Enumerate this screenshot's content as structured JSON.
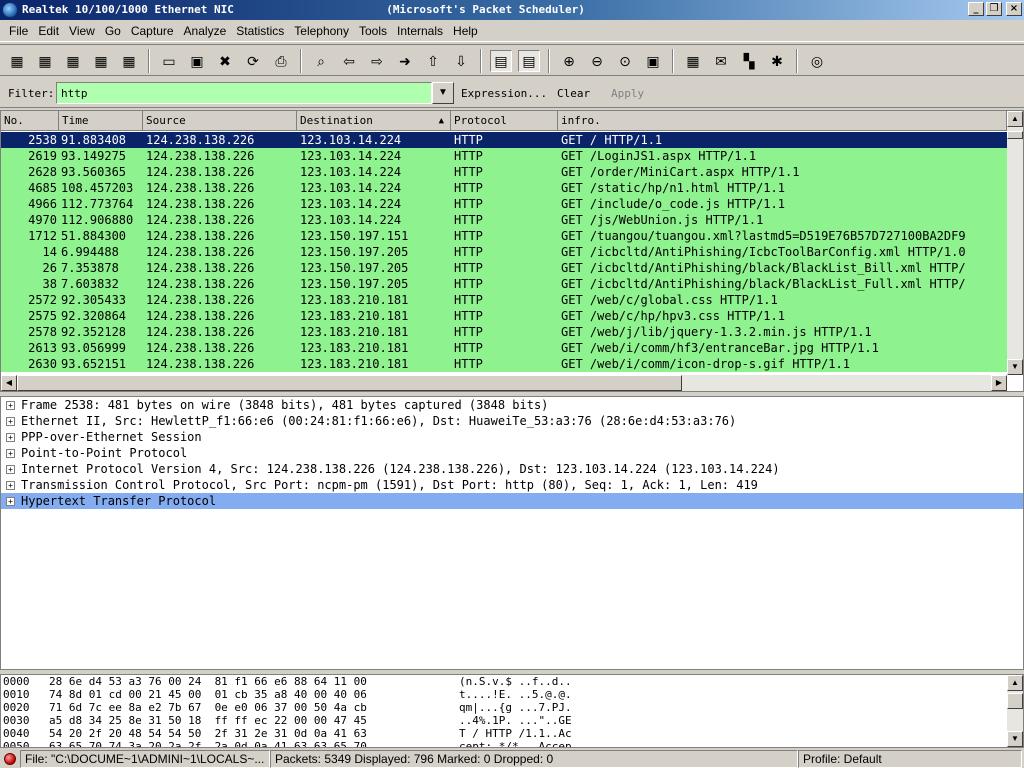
{
  "window": {
    "title": "Realtek 10/100/1000 Ethernet NIC                       (Microsoft's Packet Scheduler)",
    "minimize": "_",
    "maximize": "❐",
    "close": "×"
  },
  "menubar": {
    "items": [
      "File",
      "Edit",
      "View",
      "Go",
      "Capture",
      "Analyze",
      "Statistics",
      "Telephony",
      "Tools",
      "Internals",
      "Help"
    ]
  },
  "toolbar": {
    "icons": [
      {
        "name": "interfaces-icon",
        "glyph": "▦"
      },
      {
        "name": "capture-options-icon",
        "glyph": "▦"
      },
      {
        "name": "start-capture-icon",
        "glyph": "▦"
      },
      {
        "name": "stop-capture-icon",
        "glyph": "▦"
      },
      {
        "name": "restart-capture-icon",
        "glyph": "▦"
      },
      {
        "name": "open-file-icon",
        "glyph": "▭"
      },
      {
        "name": "save-file-icon",
        "glyph": "▣"
      },
      {
        "name": "close-file-icon",
        "glyph": "✖"
      },
      {
        "name": "reload-icon",
        "glyph": "⟳"
      },
      {
        "name": "print-icon",
        "glyph": "⎙"
      },
      {
        "name": "find-packet-icon",
        "glyph": "⌕"
      },
      {
        "name": "go-back-icon",
        "glyph": "⇦"
      },
      {
        "name": "go-forward-icon",
        "glyph": "⇨"
      },
      {
        "name": "go-to-packet-icon",
        "glyph": "➜"
      },
      {
        "name": "go-first-icon",
        "glyph": "⇧"
      },
      {
        "name": "go-last-icon",
        "glyph": "⇩"
      },
      {
        "name": "colorize-icon",
        "glyph": "▤"
      },
      {
        "name": "auto-scroll-icon",
        "glyph": "▤"
      },
      {
        "name": "zoom-in-icon",
        "glyph": "⊕"
      },
      {
        "name": "zoom-out-icon",
        "glyph": "⊖"
      },
      {
        "name": "zoom-normal-icon",
        "glyph": "⊙"
      },
      {
        "name": "resize-columns-icon",
        "glyph": "▣"
      },
      {
        "name": "capture-filters-icon",
        "glyph": "▦"
      },
      {
        "name": "display-filters-icon",
        "glyph": "✉"
      },
      {
        "name": "coloring-rules-icon",
        "glyph": "▚"
      },
      {
        "name": "preferences-icon",
        "glyph": "✱"
      },
      {
        "name": "help-icon",
        "glyph": "◎"
      }
    ]
  },
  "filter": {
    "label": "Filter:",
    "value": "http",
    "dropdown": "▼",
    "expression": "Expression...",
    "clear": "Clear",
    "apply": "Apply"
  },
  "packet_list": {
    "columns": [
      "No.",
      "Time",
      "Source",
      "Destination",
      "Protocol",
      "infro."
    ],
    "sort_arrow": "▲",
    "rows": [
      {
        "no": "2538",
        "time": "91.883408",
        "src": "124.238.138.226",
        "dst": "123.103.14.224",
        "proto": "HTTP",
        "info": "GET / HTTP/1.1"
      },
      {
        "no": "2619",
        "time": "93.149275",
        "src": "124.238.138.226",
        "dst": "123.103.14.224",
        "proto": "HTTP",
        "info": "GET /LoginJS1.aspx HTTP/1.1"
      },
      {
        "no": "2628",
        "time": "93.560365",
        "src": "124.238.138.226",
        "dst": "123.103.14.224",
        "proto": "HTTP",
        "info": "GET /order/MiniCart.aspx HTTP/1.1"
      },
      {
        "no": "4685",
        "time": "108.457203",
        "src": "124.238.138.226",
        "dst": "123.103.14.224",
        "proto": "HTTP",
        "info": "GET /static/hp/n1.html HTTP/1.1"
      },
      {
        "no": "4966",
        "time": "112.773764",
        "src": "124.238.138.226",
        "dst": "123.103.14.224",
        "proto": "HTTP",
        "info": "GET /include/o_code.js HTTP/1.1"
      },
      {
        "no": "4970",
        "time": "112.906880",
        "src": "124.238.138.226",
        "dst": "123.103.14.224",
        "proto": "HTTP",
        "info": "GET /js/WebUnion.js HTTP/1.1"
      },
      {
        "no": "1712",
        "time": "51.884300",
        "src": "124.238.138.226",
        "dst": "123.150.197.151",
        "proto": "HTTP",
        "info": "GET /tuangou/tuangou.xml?lastmd5=D519E76B57D727100BA2DF9"
      },
      {
        "no": "14",
        "time": "6.994488",
        "src": "124.238.138.226",
        "dst": "123.150.197.205",
        "proto": "HTTP",
        "info": "GET /icbcltd/AntiPhishing/IcbcToolBarConfig.xml HTTP/1.0"
      },
      {
        "no": "26",
        "time": "7.353878",
        "src": "124.238.138.226",
        "dst": "123.150.197.205",
        "proto": "HTTP",
        "info": "GET /icbcltd/AntiPhishing/black/BlackList_Bill.xml HTTP/"
      },
      {
        "no": "38",
        "time": "7.603832",
        "src": "124.238.138.226",
        "dst": "123.150.197.205",
        "proto": "HTTP",
        "info": "GET /icbcltd/AntiPhishing/black/BlackList_Full.xml HTTP/"
      },
      {
        "no": "2572",
        "time": "92.305433",
        "src": "124.238.138.226",
        "dst": "123.183.210.181",
        "proto": "HTTP",
        "info": "GET /web/c/global.css HTTP/1.1"
      },
      {
        "no": "2575",
        "time": "92.320864",
        "src": "124.238.138.226",
        "dst": "123.183.210.181",
        "proto": "HTTP",
        "info": "GET /web/c/hp/hpv3.css HTTP/1.1"
      },
      {
        "no": "2578",
        "time": "92.352128",
        "src": "124.238.138.226",
        "dst": "123.183.210.181",
        "proto": "HTTP",
        "info": "GET /web/j/lib/jquery-1.3.2.min.js HTTP/1.1"
      },
      {
        "no": "2613",
        "time": "93.056999",
        "src": "124.238.138.226",
        "dst": "123.183.210.181",
        "proto": "HTTP",
        "info": "GET /web/i/comm/hf3/entranceBar.jpg HTTP/1.1"
      },
      {
        "no": "2630",
        "time": "93.652151",
        "src": "124.238.138.226",
        "dst": "123.183.210.181",
        "proto": "HTTP",
        "info": "GET /web/i/comm/icon-drop-s.gif HTTP/1.1"
      }
    ]
  },
  "details": {
    "expander": "+",
    "rows": [
      "Frame 2538: 481 bytes on wire (3848 bits), 481 bytes captured (3848 bits)",
      "Ethernet II, Src: HewlettP_f1:66:e6 (00:24:81:f1:66:e6), Dst: HuaweiTe_53:a3:76 (28:6e:d4:53:a3:76)",
      "PPP-over-Ethernet Session",
      "Point-to-Point Protocol",
      "Internet Protocol Version 4, Src: 124.238.138.226 (124.238.138.226), Dst: 123.103.14.224 (123.103.14.224)",
      "Transmission Control Protocol, Src Port: ncpm-pm (1591), Dst Port: http (80), Seq: 1, Ack: 1, Len: 419",
      "Hypertext Transfer Protocol"
    ]
  },
  "hex": {
    "rows": [
      {
        "offset": "0000",
        "bytes": "28 6e d4 53 a3 76 00 24  81 f1 66 e6 88 64 11 00",
        "ascii": "(n.S.v.$ ..f..d.."
      },
      {
        "offset": "0010",
        "bytes": "74 8d 01 cd 00 21 45 00  01 cb 35 a8 40 00 40 06",
        "ascii": "t....!E. ..5.@.@."
      },
      {
        "offset": "0020",
        "bytes": "71 6d 7c ee 8a e2 7b 67  0e e0 06 37 00 50 4a cb",
        "ascii": "qm|...{g ...7.PJ."
      },
      {
        "offset": "0030",
        "bytes": "a5 d8 34 25 8e 31 50 18  ff ff ec 22 00 00 47 45",
        "ascii": "..4%.1P. ...\"..GE"
      },
      {
        "offset": "0040",
        "bytes": "54 20 2f 20 48 54 54 50  2f 31 2e 31 0d 0a 41 63",
        "ascii": "T / HTTP /1.1..Ac"
      },
      {
        "offset": "0050",
        "bytes": "63 65 70 74 3a 20 2a 2f  2a 0d 0a 41 63 63 65 70",
        "ascii": "cept: */* ..Accep"
      }
    ]
  },
  "status": {
    "file": "File: \"C:\\DOCUME~1\\ADMINI~1\\LOCALS~...",
    "packets": "Packets: 5349 Displayed: 796 Marked: 0 Dropped: 0",
    "profile": "Profile: Default"
  },
  "colors": {
    "http_row": "#8ef28e",
    "selected_row": "#0a246a",
    "filter_valid": "#afffaf",
    "tree_selected": "#84acf0"
  }
}
